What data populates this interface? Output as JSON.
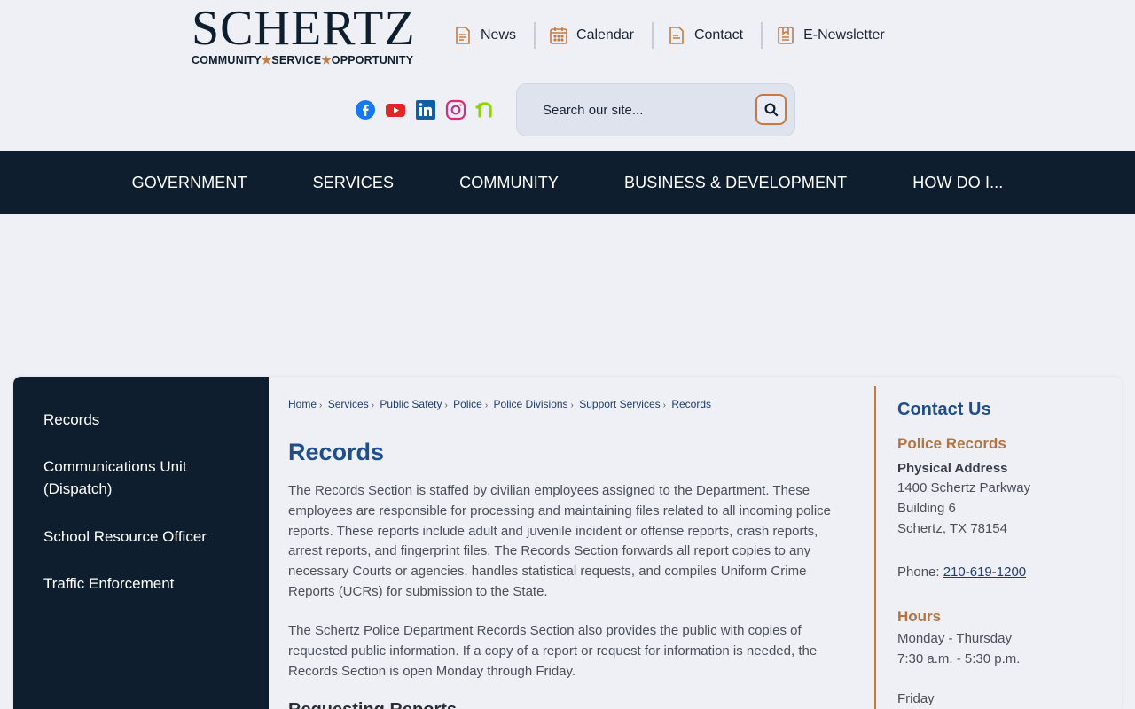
{
  "logo": {
    "wordmark": "SCHERTZ",
    "tagline_parts": [
      "COMMUNITY",
      "SERVICE",
      "OPPORTUNITY"
    ]
  },
  "toplinks": [
    {
      "label": "News",
      "icon": "news-icon"
    },
    {
      "label": "Calendar",
      "icon": "calendar-icon"
    },
    {
      "label": "Contact",
      "icon": "contact-icon"
    },
    {
      "label": "E-Newsletter",
      "icon": "newsletter-icon"
    }
  ],
  "socials": [
    "facebook-icon",
    "youtube-icon",
    "linkedin-icon",
    "instagram-icon",
    "nextdoor-icon"
  ],
  "search": {
    "placeholder": "Search our site..."
  },
  "nav": [
    "GOVERNMENT",
    "SERVICES",
    "COMMUNITY",
    "BUSINESS & DEVELOPMENT",
    "HOW DO I..."
  ],
  "sidebar": [
    {
      "label": "Records"
    },
    {
      "label": "Communications Unit (Dispatch)"
    },
    {
      "label": "School Resource Officer"
    },
    {
      "label": "Traffic Enforcement"
    }
  ],
  "breadcrumb": [
    "Home",
    "Services",
    "Public Safety",
    "Police",
    "Police Divisions",
    "Support Services",
    "Records"
  ],
  "page": {
    "title": "Records",
    "para1": "The Records Section is staffed by civilian employees assigned to the Department. These employees are responsible for processing and maintaining files related to all incoming police reports. These reports include adult and juvenile incident or offense reports, crash reports, arrest reports, and fingerprint files. The Records Section forwards all report copies to any necessary Courts or agencies, handles statistical requests, and compiles Uniform Crime Reports (UCRs) for submission to the State.",
    "para2": "The Schertz Police Department Records Section also provides the public with copies of requested public information. If a copy of a report or request for information is needed, the Records Section is open Monday through Friday.",
    "subhead": "Requesting Reports"
  },
  "contact": {
    "title": "Contact Us",
    "name": "Police Records",
    "address_label": "Physical Address",
    "address_lines": [
      "1400 Schertz Parkway",
      "Building 6",
      "Schertz, TX 78154"
    ],
    "phone_label": "Phone:",
    "phone": "210-619-1200",
    "hours_title": "Hours",
    "hours_lines": [
      "Monday - Thursday",
      "7:30 a.m. - 5:30 p.m."
    ],
    "hours_friday": "Friday"
  },
  "colors": {
    "navy": "#0e1e2e",
    "accent_orange": "#c87a3e",
    "title_blue": "#1f4e8c",
    "background": "#eef0f6"
  }
}
